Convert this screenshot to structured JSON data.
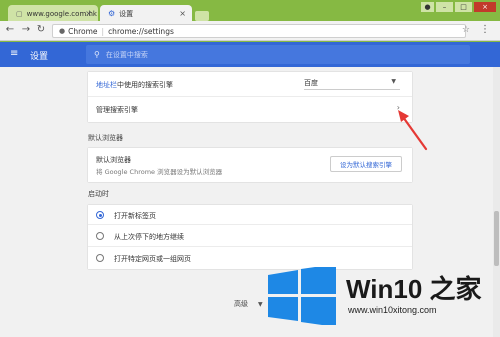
{
  "browser": {
    "tabs": [
      {
        "title": "www.google.com.hk"
      },
      {
        "title": "设置"
      }
    ],
    "omnibox": {
      "scheme_label": "Chrome",
      "url": "chrome://settings"
    }
  },
  "settings": {
    "header_title": "设置",
    "search_placeholder": "在设置中搜索",
    "search_engine": {
      "address_bar_link": "地址栏",
      "address_bar_label": "中使用的搜索引擎",
      "selected_engine": "百度",
      "manage_label": "管理搜索引擎"
    },
    "default_browser": {
      "section_title": "默认浏览器",
      "row_title": "默认浏览器",
      "row_subtitle": "将 Google Chrome 浏览器设为默认浏览器",
      "button_label": "设为默认搜索引擎"
    },
    "on_startup": {
      "section_title": "启动时",
      "options": [
        {
          "label": "打开新标签页",
          "selected": true
        },
        {
          "label": "从上次停下的地方继续",
          "selected": false
        },
        {
          "label": "打开特定网页或一组网页",
          "selected": false
        }
      ]
    },
    "advanced_label": "高级"
  },
  "watermark": {
    "brand_text": "Win10 之家",
    "url": "www.win10xitong.com"
  },
  "colors": {
    "accent": "#3367d6",
    "frame": "#86b943",
    "annotation_arrow": "#e53935"
  }
}
